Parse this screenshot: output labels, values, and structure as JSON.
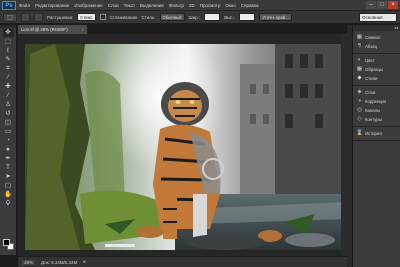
{
  "app": {
    "logo": "Ps",
    "menu": [
      "Файл",
      "Редактирование",
      "Изображение",
      "Слои",
      "Текст",
      "Выделение",
      "Фильтр",
      "3D",
      "Просмотр",
      "Окно",
      "Справка"
    ],
    "window_controls": [
      "–",
      "□",
      "×"
    ]
  },
  "options_bar": {
    "tool_icon": "brush-preset-icon",
    "feather_label": "Растушевка:",
    "feather_value": "0 пикс",
    "antialias_label": "Сглаживание",
    "style_label": "Стиль:",
    "style_value": "Обычный",
    "width_label": "Шир.:",
    "height_label": "Выс.:",
    "refine_button": "Уточн. край...",
    "workspace": "Основная рабочая среда"
  },
  "tools": [
    {
      "icon": "move-tool-icon",
      "glyph": "✥"
    },
    {
      "icon": "marquee-tool-icon",
      "glyph": "⬚"
    },
    {
      "icon": "lasso-tool-icon",
      "glyph": "ℓ"
    },
    {
      "icon": "quick-select-tool-icon",
      "glyph": "✎"
    },
    {
      "icon": "crop-tool-icon",
      "glyph": "⌗"
    },
    {
      "icon": "eyedropper-tool-icon",
      "glyph": "⁄"
    },
    {
      "icon": "healing-brush-tool-icon",
      "glyph": "✚"
    },
    {
      "icon": "brush-tool-icon",
      "glyph": "∕"
    },
    {
      "icon": "clone-stamp-tool-icon",
      "glyph": "♙"
    },
    {
      "icon": "history-brush-tool-icon",
      "glyph": "↺"
    },
    {
      "icon": "eraser-tool-icon",
      "glyph": "◫"
    },
    {
      "icon": "gradient-tool-icon",
      "glyph": "▭"
    },
    {
      "icon": "blur-tool-icon",
      "glyph": "◔"
    },
    {
      "icon": "dodge-tool-icon",
      "glyph": "●"
    },
    {
      "icon": "pen-tool-icon",
      "glyph": "✒"
    },
    {
      "icon": "type-tool-icon",
      "glyph": "T"
    },
    {
      "icon": "path-select-tool-icon",
      "glyph": "➤"
    },
    {
      "icon": "shape-tool-icon",
      "glyph": "▢"
    },
    {
      "icon": "hand-tool-icon",
      "glyph": "✋"
    },
    {
      "icon": "zoom-tool-icon",
      "glyph": "⚲"
    }
  ],
  "document": {
    "tab_title": "Lion.tif @ 49% (RGB/8*)",
    "close": "×"
  },
  "status": {
    "zoom": "49%",
    "doc_info": "Док: 5,34M/5,34M",
    "arrow": "▸"
  },
  "panels": {
    "collapse": "◂◂",
    "groups": [
      [
        {
          "icon": "swatches-icon",
          "glyph": "▦",
          "label": "Символ"
        },
        {
          "icon": "paragraph-icon",
          "glyph": "¶",
          "label": "Абзац"
        }
      ],
      [
        {
          "icon": "color-icon",
          "glyph": "◐",
          "label": "Цвет"
        },
        {
          "icon": "swatch-grid-icon",
          "glyph": "▦",
          "label": "Образцы"
        },
        {
          "icon": "styles-icon",
          "glyph": "◆",
          "label": "Стили"
        }
      ],
      [
        {
          "icon": "layers-icon",
          "glyph": "◈",
          "label": "Слои"
        },
        {
          "icon": "adjustments-icon",
          "glyph": "◑",
          "label": "Коррекция"
        },
        {
          "icon": "channels-icon",
          "glyph": "◎",
          "label": "Каналы"
        },
        {
          "icon": "paths-icon",
          "glyph": "◇",
          "label": "Контуры"
        }
      ],
      [
        {
          "icon": "history-icon",
          "glyph": "⌛",
          "label": "История"
        }
      ]
    ]
  }
}
